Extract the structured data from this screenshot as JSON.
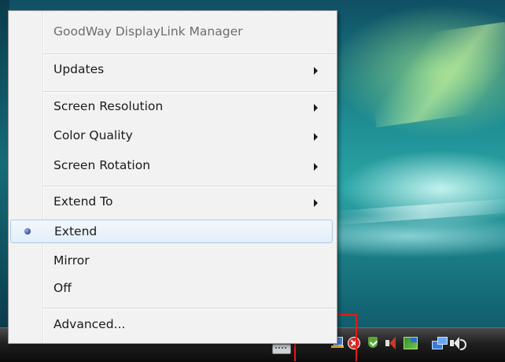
{
  "menu": {
    "header": "GoodWay DisplayLink Manager",
    "items": [
      {
        "label": "Updates",
        "submenu": true
      },
      {
        "label": "Screen Resolution",
        "submenu": true
      },
      {
        "label": "Color Quality",
        "submenu": true
      },
      {
        "label": "Screen Rotation",
        "submenu": true
      },
      {
        "label": "Extend To",
        "submenu": true
      },
      {
        "label": "Extend",
        "selected": true,
        "checked": true
      },
      {
        "label": "Mirror"
      },
      {
        "label": "Off"
      },
      {
        "label": "Advanced..."
      }
    ]
  },
  "taskbar": {
    "tray_icons": [
      "keyboard-icon",
      "network-icon",
      "stop-icon",
      "shield-icon",
      "speaker-alert-icon",
      "app-icon",
      "display-link-icon",
      "volume-icon"
    ]
  },
  "colors": {
    "highlight_border": "#e31b1b",
    "menu_background": "#f2f2f2",
    "selected_item_border": "#aacbe8"
  }
}
